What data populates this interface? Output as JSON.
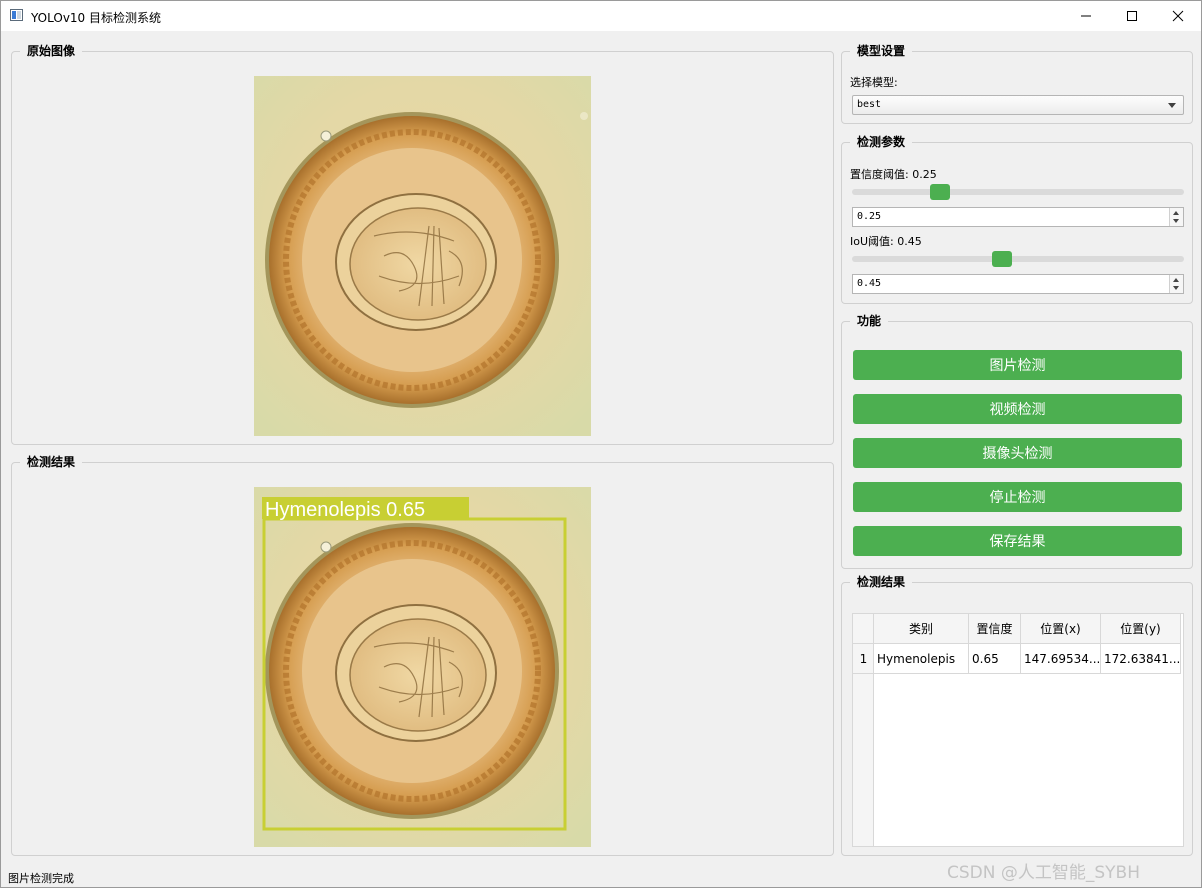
{
  "window": {
    "title": "YOLOv10 目标检测系统"
  },
  "original_panel": {
    "title": "原始图像"
  },
  "result_panel": {
    "title": "检测结果",
    "box_label": "Hymenolepis 0.65"
  },
  "model_settings": {
    "title": "模型设置",
    "select_label": "选择模型:",
    "selected_model": "best"
  },
  "detect_params": {
    "title": "检测参数",
    "conf_label": "置信度阈值: 0.25",
    "conf_value": "0.25",
    "conf_level": 0.25,
    "iou_label": "IoU阈值: 0.45",
    "iou_value": "0.45",
    "iou_level": 0.45
  },
  "functions": {
    "title": "功能",
    "image_detect": "图片检测",
    "video_detect": "视频检测",
    "camera_detect": "摄像头检测",
    "stop_detect": "停止检测",
    "save_results": "保存结果"
  },
  "results_table": {
    "title": "检测结果",
    "headers": [
      "类别",
      "置信度",
      "位置(x)",
      "位置(y)"
    ],
    "rows": [
      {
        "index": "1",
        "cells": [
          "Hymenolepis",
          "0.65",
          "147.69534...",
          "172.63841..."
        ]
      }
    ]
  },
  "status_bar": {
    "text": "图片检测完成"
  },
  "watermark": "CSDN @人工智能_SYBH",
  "colors": {
    "accent_green": "#4caf50",
    "bbox_color": "#c8cf33"
  }
}
